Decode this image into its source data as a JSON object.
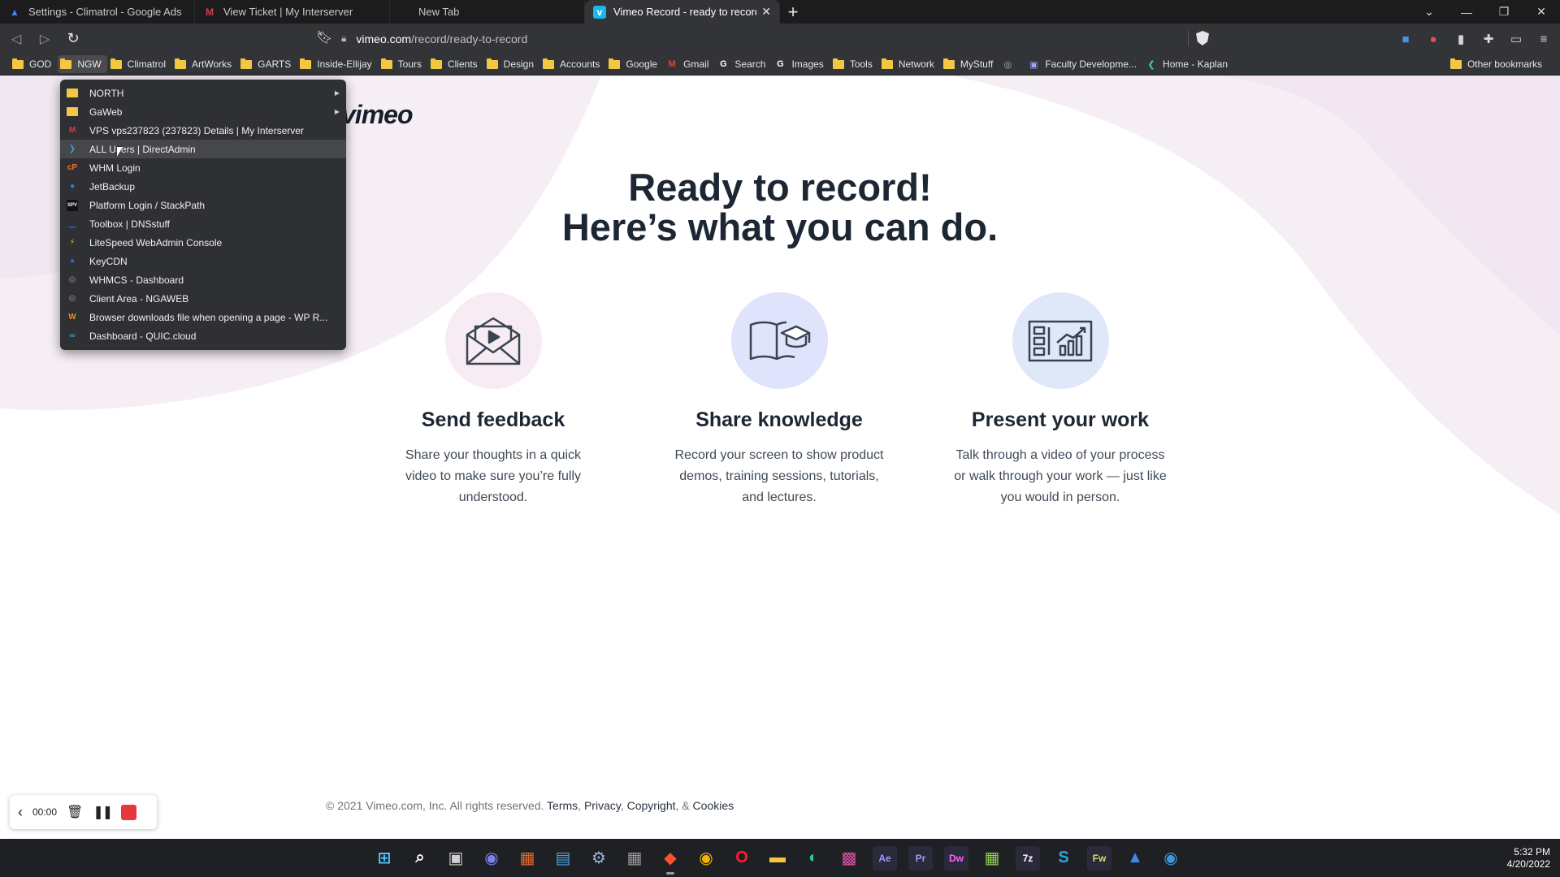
{
  "tabs": [
    {
      "title": "Settings - Climatrol - Google Ads",
      "icon": "google-ads-icon",
      "color": "#4285f4",
      "glyph": "▲"
    },
    {
      "title": "View Ticket | My Interserver",
      "icon": "interserver-icon",
      "color": "#d23b4f",
      "glyph": "M"
    },
    {
      "title": "New Tab",
      "icon": "none",
      "color": "",
      "glyph": ""
    },
    {
      "title": "Vimeo Record - ready to record",
      "icon": "vimeo-icon",
      "color": "#1ab7ea",
      "glyph": "v"
    }
  ],
  "toolbar": {
    "url_host": "vimeo.com",
    "url_path": "/record/ready-to-record"
  },
  "bookmarks": [
    {
      "label": "GOD",
      "type": "folder"
    },
    {
      "label": "NGW",
      "type": "folder"
    },
    {
      "label": "Climatrol",
      "type": "folder"
    },
    {
      "label": "ArtWorks",
      "type": "folder"
    },
    {
      "label": "GARTS",
      "type": "folder"
    },
    {
      "label": "Inside-Ellijay",
      "type": "folder"
    },
    {
      "label": "Tours",
      "type": "folder"
    },
    {
      "label": "Clients",
      "type": "folder"
    },
    {
      "label": "Design",
      "type": "folder"
    },
    {
      "label": "Accounts",
      "type": "folder"
    },
    {
      "label": "Google",
      "type": "folder"
    },
    {
      "label": "Gmail",
      "type": "link",
      "glyph": "M",
      "color": "#ea4335"
    },
    {
      "label": "Search",
      "type": "link",
      "glyph": "G",
      "color": "#ffffff"
    },
    {
      "label": "Images",
      "type": "link",
      "glyph": "G",
      "color": "#ffffff"
    },
    {
      "label": "Tools",
      "type": "folder"
    },
    {
      "label": "Network",
      "type": "folder"
    },
    {
      "label": "MyStuff",
      "type": "folder"
    },
    {
      "label": "",
      "type": "link",
      "glyph": "◎",
      "color": "#bbbbbb"
    },
    {
      "label": "Faculty Developme...",
      "type": "link",
      "glyph": "▣",
      "color": "#9aa8ff"
    },
    {
      "label": "Home - Kaplan",
      "type": "link",
      "glyph": "❮",
      "color": "#3ddc84"
    }
  ],
  "other_bookmarks": "Other bookmarks",
  "dropdown": [
    {
      "label": "NORTH",
      "type": "folder",
      "submenu": true
    },
    {
      "label": "GaWeb",
      "type": "folder",
      "submenu": true
    },
    {
      "label": "VPS vps237823 (237823) Details | My Interserver",
      "glyph": "M",
      "color": "#d23b4f"
    },
    {
      "label": "ALL Users | DirectAdmin",
      "glyph": "❯",
      "color": "#3c9be0"
    },
    {
      "label": "WHM Login",
      "glyph": "cP",
      "color": "#ff6c2c"
    },
    {
      "label": "JetBackup",
      "glyph": "●",
      "color": "#1e88e5"
    },
    {
      "label": "Platform Login / StackPath",
      "glyph": "SPV",
      "color": "#ffffff"
    },
    {
      "label": "Toolbox | DNSstuff",
      "glyph": "▁",
      "color": "#1e6ad9"
    },
    {
      "label": "LiteSpeed WebAdmin Console",
      "glyph": "⚡",
      "color": "#f5a623"
    },
    {
      "label": "KeyCDN",
      "glyph": "●",
      "color": "#1773d6"
    },
    {
      "label": "WHMCS - Dashboard",
      "glyph": "◎",
      "color": "#9a9a9a"
    },
    {
      "label": "Client Area - NGAWEB",
      "glyph": "◎",
      "color": "#9a9a9a"
    },
    {
      "label": "Browser downloads file when opening a page - WP R...",
      "glyph": "W",
      "color": "#e38b2c"
    },
    {
      "label": "Dashboard - QUIC.cloud",
      "glyph": "∞",
      "color": "#3aa0d8"
    }
  ],
  "page": {
    "brand": "vimeo",
    "hero_line1": "Ready to record!",
    "hero_line2": "Here’s what you can do.",
    "features": [
      {
        "title": "Send feedback",
        "text": "Share your thoughts in a quick video to make sure you’re fully understood.",
        "icon": "envelope-play-icon",
        "bg": "#f7ecf3"
      },
      {
        "title": "Share knowledge",
        "text": "Record your screen to show product demos, training sessions, tutorials, and lectures.",
        "icon": "book-graduation-icon",
        "bg": "#dfe3fb"
      },
      {
        "title": "Present your work",
        "text": "Talk through a video of your process or walk through your work — just like you would in person.",
        "icon": "presentation-chart-icon",
        "bg": "#dfe8f8"
      }
    ],
    "footer_copyright": "© 2021 Vimeo.com, Inc. All rights reserved.",
    "footer_terms": "Terms",
    "footer_privacy": "Privacy",
    "footer_copyright_link": "Copyright",
    "footer_and": ", &",
    "footer_cookies": "Cookies"
  },
  "recorder": {
    "time": "00:00"
  },
  "taskbar": {
    "apps": [
      {
        "name": "windows-start-icon",
        "glyph": "⊞",
        "color": "#4cc2ff"
      },
      {
        "name": "search-icon",
        "glyph": "⌕",
        "color": "#ffffff"
      },
      {
        "name": "task-view-icon",
        "glyph": "▣",
        "color": "#d0d0d0"
      },
      {
        "name": "teams-chat-icon",
        "glyph": "◉",
        "color": "#7b83eb"
      },
      {
        "name": "app-icon-1",
        "glyph": "▦",
        "color": "#e06c2c"
      },
      {
        "name": "notepad-icon",
        "glyph": "▤",
        "color": "#4aa3df"
      },
      {
        "name": "settings-icon",
        "glyph": "⚙",
        "color": "#9ab4d4"
      },
      {
        "name": "calculator-icon",
        "glyph": "▦",
        "color": "#9a9a9a"
      },
      {
        "name": "brave-icon",
        "glyph": "◆",
        "color": "#fb542b"
      },
      {
        "name": "chrome-icon",
        "glyph": "◉",
        "color": "#f4b400"
      },
      {
        "name": "opera-icon",
        "glyph": "O",
        "color": "#ff1b2d"
      },
      {
        "name": "file-explorer-icon",
        "glyph": "▬",
        "color": "#f2c744"
      },
      {
        "name": "edge-icon",
        "glyph": "◐",
        "color": "#32c5a8"
      },
      {
        "name": "photos-icon",
        "glyph": "▩",
        "color": "#e34fa8"
      },
      {
        "name": "after-effects-icon",
        "glyph": "Ae",
        "color": "#9999ff"
      },
      {
        "name": "premiere-icon",
        "glyph": "Pr",
        "color": "#9999ff"
      },
      {
        "name": "dreamweaver-icon",
        "glyph": "Dw",
        "color": "#ff61f6"
      },
      {
        "name": "network-app-icon",
        "glyph": "▦",
        "color": "#8fd14f"
      },
      {
        "name": "7zip-icon",
        "glyph": "7z",
        "color": "#ffffff"
      },
      {
        "name": "s-app-icon",
        "glyph": "S",
        "color": "#2aa6e0"
      },
      {
        "name": "fireworks-icon",
        "glyph": "Fw",
        "color": "#d4e157"
      },
      {
        "name": "google-ads-icon",
        "glyph": "▲",
        "color": "#4285f4"
      },
      {
        "name": "chat-app-icon",
        "glyph": "◉",
        "color": "#3a9ad9"
      }
    ],
    "time": "5:32 PM",
    "date": "4/20/2022"
  }
}
